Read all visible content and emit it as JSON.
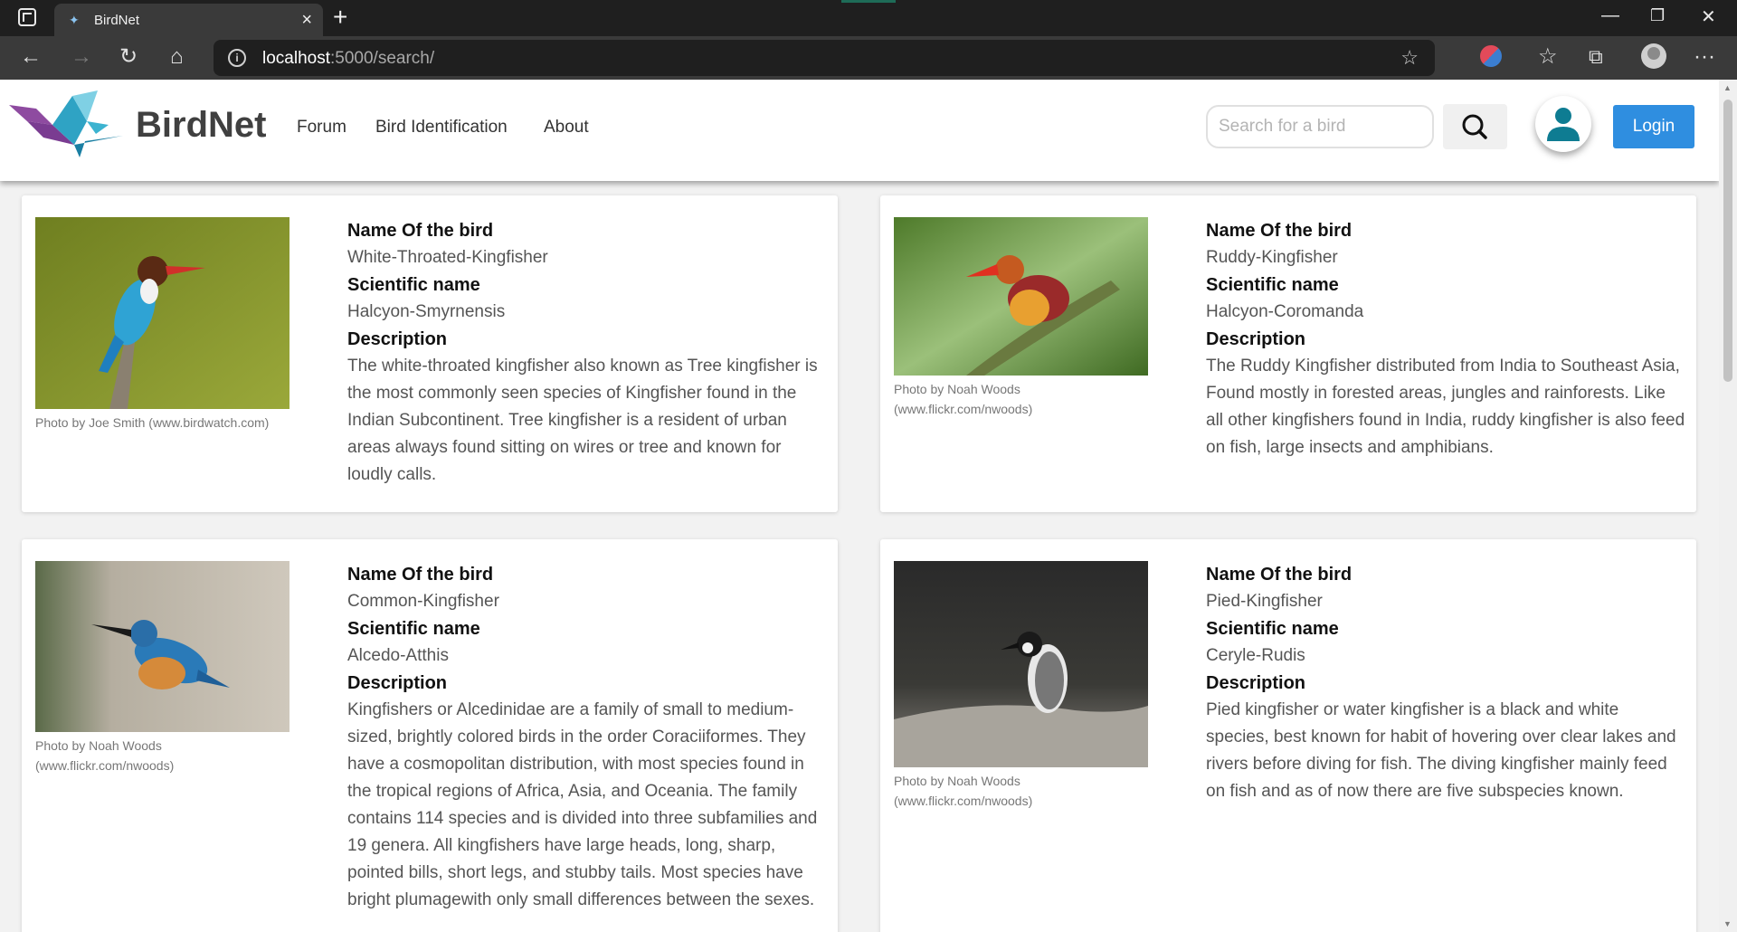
{
  "browser": {
    "tab_title": "BirdNet",
    "url_host": "localhost",
    "url_path": ":5000/search/"
  },
  "site": {
    "brand": "BirdNet",
    "nav": [
      "Forum",
      "Bird Identification",
      "About"
    ],
    "search_placeholder": "Search for a bird",
    "login_label": "Login"
  },
  "labels": {
    "name": "Name Of the bird",
    "scientific": "Scientific name",
    "description": "Description"
  },
  "birds": [
    {
      "name": "White-Throated-Kingfisher",
      "scientific": "Halcyon-Smyrnensis",
      "description": "The white-throated kingfisher also known as Tree kingfisher is the most commonly seen species of Kingfisher found in the Indian Subcontinent. Tree kingfisher is a resident of urban areas always found sitting on wires or tree and known for loudly calls.",
      "credit": "Photo by Joe Smith (www.birdwatch.com)"
    },
    {
      "name": "Ruddy-Kingfisher",
      "scientific": "Halcyon-Coromanda",
      "description": "The Ruddy Kingfisher distributed from India to Southeast Asia, Found mostly in forested areas, jungles and rainforests. Like all other kingfishers found in India, ruddy kingfisher is also feed on fish, large insects and amphibians.",
      "credit": "Photo by Noah Woods (www.flickr.com/nwoods)"
    },
    {
      "name": "Common-Kingfisher",
      "scientific": "Alcedo-Atthis",
      "description": "Kingfishers or Alcedinidae are a family of small to medium-sized, brightly colored birds in the order Coraciiformes. They have a cosmopolitan distribution, with most species found in the tropical regions of Africa, Asia, and Oceania. The family contains 114 species and is divided into three subfamilies and 19 genera. All kingfishers have large heads, long, sharp, pointed bills, short legs, and stubby tails. Most species have bright plumagewith only small differences between the sexes.",
      "credit": "Photo by Noah Woods (www.flickr.com/nwoods)"
    },
    {
      "name": "Pied-Kingfisher",
      "scientific": "Ceryle-Rudis",
      "description": "Pied kingfisher or water kingfisher is a black and white species, best known for habit of hovering over clear lakes and rivers before diving for fish. The diving kingfisher mainly feed on fish and as of now there are five subspecies known.",
      "credit": "Photo by Noah Woods (www.flickr.com/nwoods)"
    }
  ]
}
